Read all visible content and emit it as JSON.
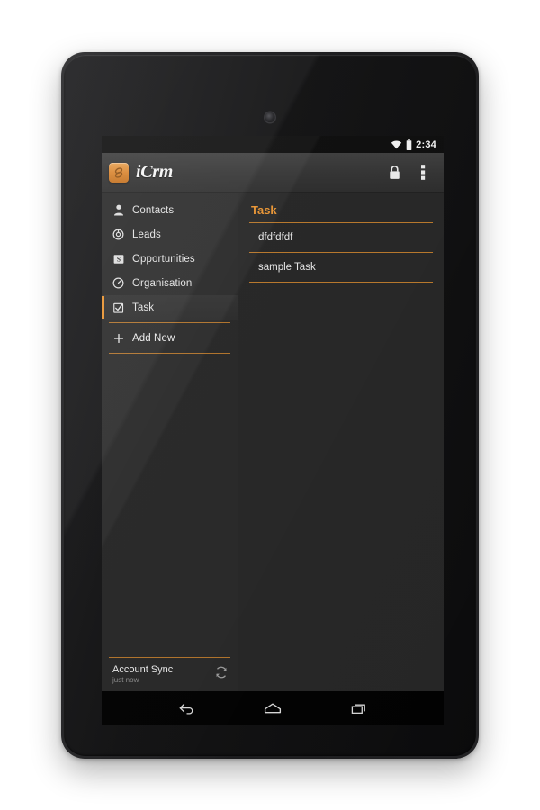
{
  "device": {
    "name": "android-tablet",
    "camera": "front-camera",
    "sensor": "notification-led"
  },
  "status_bar": {
    "time": "2:34",
    "wifi_icon": "wifi-icon",
    "battery_icon": "battery-icon"
  },
  "app_bar": {
    "logo_icon": "icrm-logo-icon",
    "app_title": "iCrm",
    "lock_icon": "lock-icon",
    "overflow_icon": "overflow-menu-icon"
  },
  "sidebar": {
    "items": [
      {
        "label": "Contacts",
        "icon": "person-icon",
        "selected": false
      },
      {
        "label": "Leads",
        "icon": "target-icon",
        "selected": false
      },
      {
        "label": "Opportunities",
        "icon": "money-icon",
        "selected": false
      },
      {
        "label": "Organisation",
        "icon": "speedometer-icon",
        "selected": false
      },
      {
        "label": "Task",
        "icon": "checkbox-icon",
        "selected": true
      }
    ],
    "add_new": {
      "label": "Add New",
      "icon": "plus-icon"
    },
    "account_sync": {
      "title": "Account Sync",
      "subtitle": "just now",
      "icon": "refresh-icon"
    }
  },
  "detail": {
    "title": "Task",
    "rows": [
      {
        "label": "dfdfdfdf"
      },
      {
        "label": "sample Task"
      }
    ]
  },
  "nav_bar": {
    "back_icon": "back-icon",
    "home_icon": "home-icon",
    "recents_icon": "recents-icon"
  },
  "colors": {
    "accent": "#e8912d",
    "divider": "#c77f2a",
    "sidebar_bg": "#262626",
    "detail_bg": "#242424",
    "appbar_bg": "#313131",
    "text": "#e6e6e6"
  }
}
